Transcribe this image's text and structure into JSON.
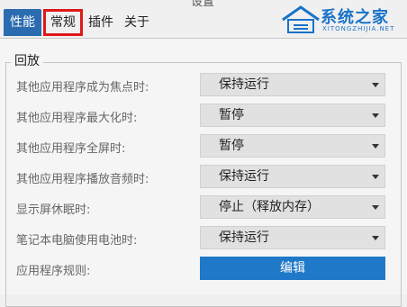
{
  "window": {
    "title": "设置"
  },
  "tabs": [
    {
      "label": "性能"
    },
    {
      "label": "常规"
    },
    {
      "label": "插件"
    },
    {
      "label": "关于"
    }
  ],
  "watermark": {
    "site": "系统之家",
    "url": "XITONGZHIJIA.NET"
  },
  "group": {
    "title": "回放"
  },
  "rows": [
    {
      "label": "其他应用程序成为焦点时:",
      "value": "保持运行"
    },
    {
      "label": "其他应用程序最大化时:",
      "value": "暂停"
    },
    {
      "label": "其他应用程序全屏时:",
      "value": "暂停"
    },
    {
      "label": "其他应用程序播放音频时:",
      "value": "保持运行"
    },
    {
      "label": "显示屏休眠时:",
      "value": "停止（释放内存）"
    },
    {
      "label": "笔记本电脑使用电池时:",
      "value": "保持运行"
    }
  ],
  "rules": {
    "label": "应用程序规则:",
    "button": "编辑"
  },
  "colors": {
    "accent": "#2b6cb0",
    "highlight": "#e01818",
    "button": "#1f79c8"
  }
}
